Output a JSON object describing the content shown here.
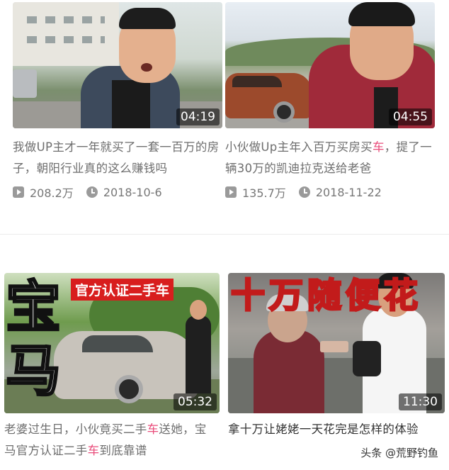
{
  "videos": [
    {
      "title_parts": [
        {
          "text": "我做UP主才一年就买了一套一百万的房子，朝阳行业真的这么赚钱吗",
          "highlight": false
        }
      ],
      "duration": "04:19",
      "views": "208.2万",
      "date": "2018-10-6"
    },
    {
      "title_parts": [
        {
          "text": "小伙做Up主年入百万买房买",
          "highlight": false
        },
        {
          "text": "车",
          "highlight": true
        },
        {
          "text": "，提了一辆30万的凯迪拉克送给老爸",
          "highlight": false
        }
      ],
      "duration": "04:55",
      "views": "135.7万",
      "date": "2018-11-22"
    },
    {
      "title_parts": [
        {
          "text": "老婆过生日，小伙竟买二手",
          "highlight": false
        },
        {
          "text": "车",
          "highlight": true
        },
        {
          "text": "送她，宝马官方认证二手",
          "highlight": false
        },
        {
          "text": "车",
          "highlight": true
        },
        {
          "text": "到底靠谱",
          "highlight": false
        }
      ],
      "duration": "05:32",
      "thumb_text_big": "宝马",
      "thumb_text_banner": "官方认证二手车"
    },
    {
      "title_parts": [
        {
          "text": "拿十万让姥姥一天花完是怎样的体验",
          "highlight": false
        }
      ],
      "duration": "11:30",
      "thumb_text_big": "十万随便花"
    }
  ],
  "icons": {
    "views": "play-count-icon",
    "date": "clock-icon"
  },
  "colors": {
    "highlight": "#e94b7a",
    "banner_red": "#d81e1e"
  },
  "watermark": "头条 @荒野钓鱼"
}
